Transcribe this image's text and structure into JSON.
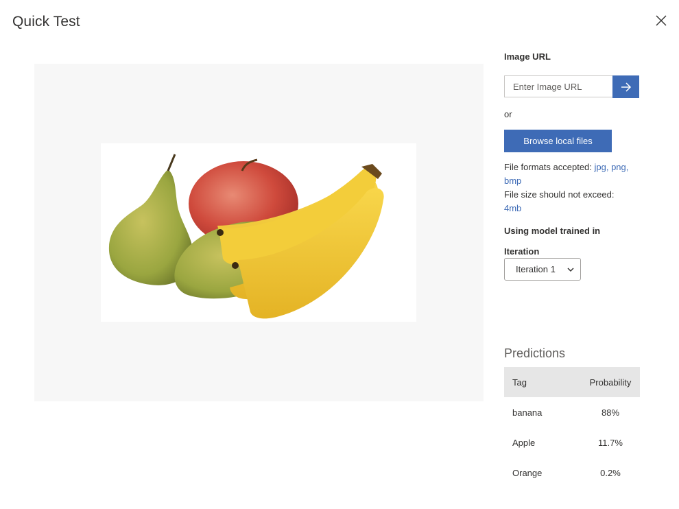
{
  "dialog": {
    "title": "Quick Test"
  },
  "image_panel": {
    "alt": "pears, apple and bananas"
  },
  "image_url": {
    "label": "Image URL",
    "placeholder": "Enter Image URL"
  },
  "or_text": "or",
  "browse_button": "Browse local files",
  "file_formats": {
    "prefix": "File formats accepted: ",
    "formats": "jpg, png,",
    "formats_cont": "bmp"
  },
  "file_size": {
    "prefix": "File size should not exceed:",
    "limit": "4mb"
  },
  "model": {
    "label": "Using model trained in",
    "iteration_label": "Iteration",
    "iteration_value": "Iteration 1"
  },
  "predictions": {
    "title": "Predictions",
    "columns": [
      "Tag",
      "Probability"
    ],
    "rows": [
      {
        "tag": "banana",
        "probability": "88%"
      },
      {
        "tag": "Apple",
        "probability": "11.7%"
      },
      {
        "tag": "Orange",
        "probability": "0.2%"
      }
    ]
  },
  "colors": {
    "accent": "#3e6bb6",
    "panel_bg": "#f7f7f7",
    "table_header_bg": "#e6e6e6"
  },
  "icons": {
    "close": "close-icon",
    "submit": "arrow-right-icon",
    "dropdown": "chevron-down-icon"
  }
}
